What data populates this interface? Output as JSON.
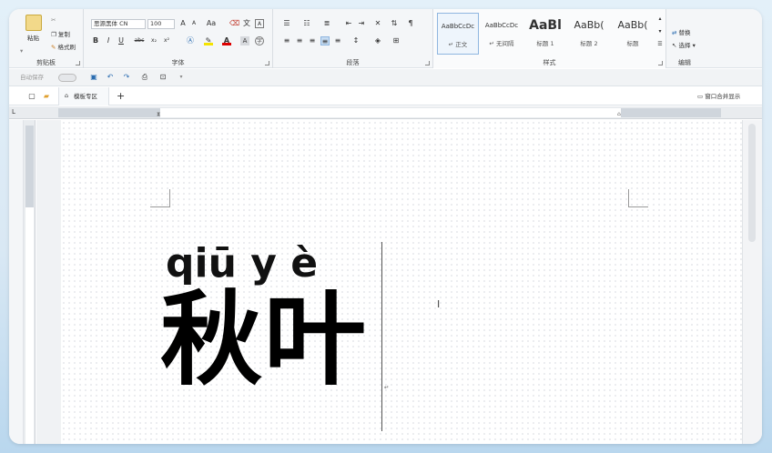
{
  "ribbon": {
    "clipboard": {
      "paste": "粘贴",
      "copy": "复制",
      "format_painter": "格式刷",
      "group_label": "剪贴板"
    },
    "font": {
      "font_name": "思源黑体 CN",
      "font_size": "100",
      "group_label": "字体",
      "grow": "A",
      "shrink": "A",
      "change_case": "Aa",
      "bold": "B",
      "italic": "I",
      "underline": "U",
      "strike": "abc",
      "subscript": "x₂",
      "superscript": "x²"
    },
    "paragraph": {
      "group_label": "段落"
    },
    "styles": {
      "group_label": "样式",
      "items": [
        {
          "preview": "AaBbCcDc",
          "name": "↵ 正文"
        },
        {
          "preview": "AaBbCcDc",
          "name": "↵ 无间隔"
        },
        {
          "preview": "AaBl",
          "name": "标题 1"
        },
        {
          "preview": "AaBb(",
          "name": "标题 2"
        },
        {
          "preview": "AaBb(",
          "name": "标题"
        }
      ]
    },
    "editing": {
      "replace": "替换",
      "select": "选择",
      "group_label": "编辑"
    }
  },
  "qat": {
    "label": "自动保存"
  },
  "tabs": {
    "template_tab": "模板专区",
    "add": "+",
    "window_action": "窗口合并显示"
  },
  "document": {
    "pinyin": "qiū y è",
    "hanzi": "秋叶"
  },
  "colors": {
    "accent": "#2b6cb0",
    "ribbon_bg": "#f4f6f8"
  }
}
